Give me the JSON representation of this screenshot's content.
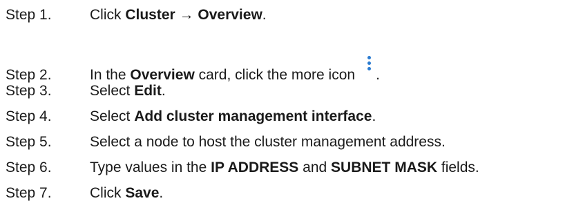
{
  "steps": [
    {
      "number": "Step 1.",
      "parts": [
        "Click ",
        "Cluster",
        " ",
        "→",
        " ",
        "Overview",
        "."
      ]
    },
    {
      "number": "Step 2.",
      "parts": [
        "In the ",
        "Overview",
        " card, click the more icon",
        "."
      ]
    },
    {
      "number": "Step 3.",
      "parts": [
        "Select ",
        "Edit",
        "."
      ]
    },
    {
      "number": "Step 4.",
      "parts": [
        "Select ",
        "Add cluster management interface",
        "."
      ]
    },
    {
      "number": "Step 5.",
      "parts": [
        "Select a node to host the cluster management address."
      ]
    },
    {
      "number": "Step 6.",
      "parts": [
        "Type values in the ",
        "IP ADDRESS",
        " and ",
        "SUBNET MASK",
        " fields."
      ]
    },
    {
      "number": "Step 7.",
      "parts": [
        "Click ",
        "Save",
        "."
      ]
    }
  ],
  "icons": {
    "more_icon": "vertical-ellipsis-icon",
    "more_icon_color": "#2a7bd0"
  }
}
